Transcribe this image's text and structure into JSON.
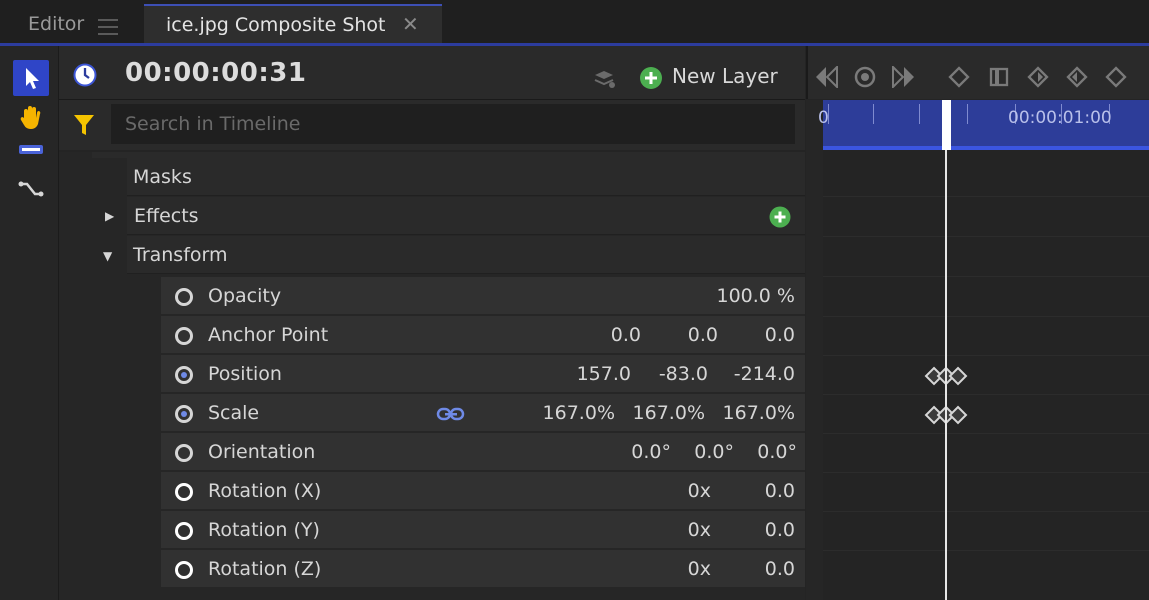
{
  "tabs": [
    {
      "label": "Editor",
      "active": false
    },
    {
      "label": "ice.jpg Composite Shot",
      "active": true
    }
  ],
  "toolbar": {
    "timecode": "00:00:00:31",
    "new_layer_label": "New Layer"
  },
  "search": {
    "placeholder": "Search in Timeline"
  },
  "layers": [
    {
      "label": "Masks"
    },
    {
      "label": "Effects",
      "expanded": false
    },
    {
      "label": "Transform",
      "expanded": true
    }
  ],
  "properties": [
    {
      "name": "Opacity",
      "values": [
        "100.0 %"
      ],
      "keyframed": false
    },
    {
      "name": "Anchor Point",
      "values": [
        "0.0",
        "0.0",
        "0.0"
      ],
      "keyframed": false
    },
    {
      "name": "Position",
      "values": [
        "157.0",
        "-83.0",
        "-214.0"
      ],
      "keyframed": true
    },
    {
      "name": "Scale",
      "values": [
        "167.0%",
        "167.0%",
        "167.0%"
      ],
      "keyframed": true,
      "linked": true
    },
    {
      "name": "Orientation",
      "values": [
        "0.0°",
        "0.0°",
        "0.0°"
      ],
      "keyframed": false
    },
    {
      "name": "Rotation (X)",
      "values": [
        "0x",
        "0.0"
      ],
      "keyframed": false
    },
    {
      "name": "Rotation (Y)",
      "values": [
        "0x",
        "0.0"
      ],
      "keyframed": false
    },
    {
      "name": "Rotation (Z)",
      "values": [
        "0x",
        "0.0"
      ],
      "keyframed": false
    }
  ],
  "timeline": {
    "start_label": "0",
    "marker_label": "00:00:01:00"
  },
  "colors": {
    "accent": "#2f45c7",
    "ruler": "#2d3d99",
    "add_green": "#4caf50"
  }
}
